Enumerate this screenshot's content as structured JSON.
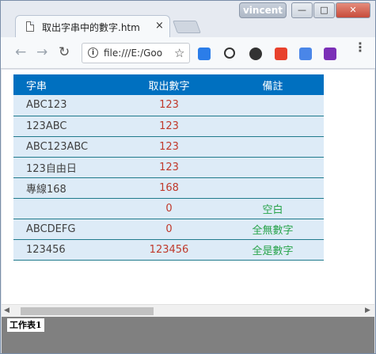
{
  "window": {
    "user": "vincent",
    "min_glyph": "—",
    "max_glyph": "□",
    "close_glyph": "✕"
  },
  "tab": {
    "title": "取出字串中的數字.htm",
    "close_glyph": "×"
  },
  "toolbar": {
    "back_glyph": "←",
    "forward_glyph": "→",
    "reload_glyph": "↻",
    "info_glyph": "i",
    "url": "file:///E:/Goo",
    "star_glyph": "☆",
    "menu_glyph": "⋮",
    "extensions": [
      "tasks-icon",
      "eyedropper-icon",
      "evernote-icon",
      "flipboard-icon",
      "translate-icon",
      "onenote-icon"
    ]
  },
  "table": {
    "headers": [
      "字串",
      "取出數字",
      "備註"
    ],
    "rows": [
      [
        "ABC123",
        "123",
        ""
      ],
      [
        "123ABC",
        "123",
        ""
      ],
      [
        "ABC123ABC",
        "123",
        ""
      ],
      [
        "123自由日",
        "123",
        ""
      ],
      [
        "專線168",
        "168",
        ""
      ],
      [
        "",
        "0",
        "空白"
      ],
      [
        "ABCDEFG",
        "0",
        "全無數字"
      ],
      [
        "123456",
        "123456",
        "全是數字"
      ]
    ],
    "colors": {
      "header_bg": "#0070c0",
      "row_bg": "#ddebf7",
      "number": "#c0392b",
      "note": "#27a34a"
    }
  },
  "scrollbar": {
    "left_glyph": "◀",
    "right_glyph": "▶"
  },
  "sheets": [
    "工作表1"
  ]
}
